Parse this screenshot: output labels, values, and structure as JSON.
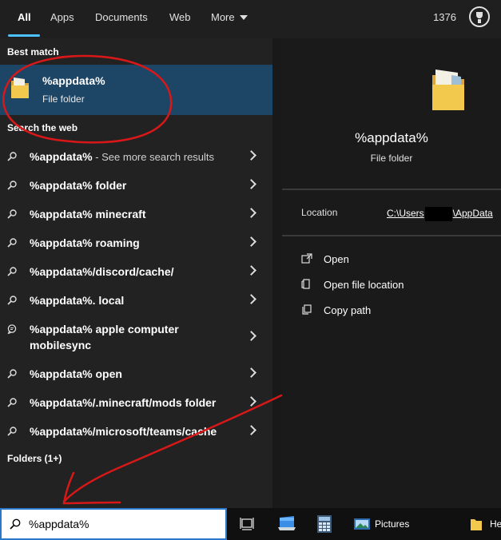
{
  "tabs": [
    {
      "label": "All"
    },
    {
      "label": "Apps"
    },
    {
      "label": "Documents"
    },
    {
      "label": "Web"
    },
    {
      "label": "More"
    }
  ],
  "points": "1376",
  "sections": {
    "best_match": "Best match",
    "search_web": "Search the web",
    "folders": "Folders (1+)"
  },
  "best": {
    "title": "%appdata%",
    "subtitle": "File folder"
  },
  "web_results": [
    {
      "text": "%appdata%",
      "suffix": " - See more search results",
      "icon": "search-icon"
    },
    {
      "text": "%appdata% folder",
      "icon": "search-icon"
    },
    {
      "text": "%appdata% minecraft",
      "icon": "search-icon"
    },
    {
      "text": "%appdata% roaming",
      "icon": "search-icon"
    },
    {
      "text": "%appdata%/discord/cache/",
      "icon": "search-icon"
    },
    {
      "text": "%appdata%. local",
      "icon": "search-icon"
    },
    {
      "text": "%appdata% apple computer",
      "text2": "mobilesync",
      "icon": "chat-icon"
    },
    {
      "text": "%appdata% open",
      "icon": "search-icon"
    },
    {
      "text": "%appdata%/.minecraft/mods folder",
      "icon": "search-icon"
    },
    {
      "text": "%appdata%/microsoft/teams/cache",
      "icon": "search-icon"
    }
  ],
  "preview": {
    "title": "%appdata%",
    "subtitle": "File folder",
    "location_label": "Location",
    "location_prefix": "C:\\Users",
    "location_suffix": "\\AppData",
    "actions": [
      {
        "label": "Open",
        "icon": "open-external-icon"
      },
      {
        "label": "Open file location",
        "icon": "file-location-icon"
      },
      {
        "label": "Copy path",
        "icon": "copy-icon"
      }
    ]
  },
  "search": {
    "value": "%appdata%"
  },
  "taskbar": {
    "pictures_label": "Pictures",
    "truncated_label": "He"
  },
  "colors": {
    "accent": "#4cc2ff",
    "selection": "#1d4566",
    "annotation": "#d81818"
  }
}
